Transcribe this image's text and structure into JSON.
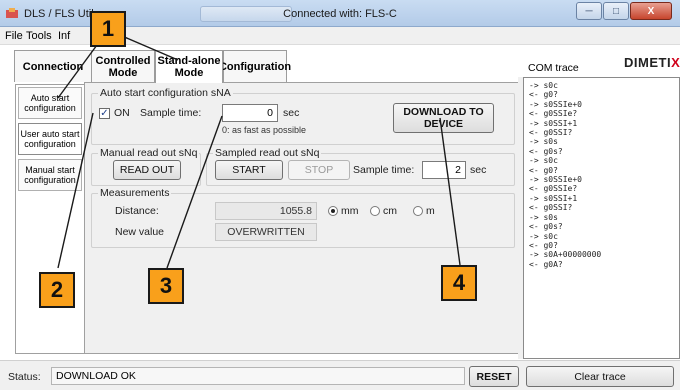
{
  "window": {
    "app_title": "DLS / FLS Util",
    "connection_title": "Connected with: FLS-C",
    "minimize_label": "─",
    "maximize_label": "□",
    "close_label": "X"
  },
  "menu": {
    "items": [
      "File",
      "Tools",
      "Inf"
    ]
  },
  "tabs": [
    {
      "label": "Connection"
    },
    {
      "label": "Controlled Mode"
    },
    {
      "label": "Stand-alone Mode"
    },
    {
      "label": "Configuration"
    }
  ],
  "side_items": [
    {
      "label": "Auto start configuration"
    },
    {
      "label": "User auto start configuration"
    },
    {
      "label": "Manual start configuration"
    }
  ],
  "auto_start": {
    "group_title": "Auto start configuration sNA",
    "on_label": "ON",
    "on_checked": true,
    "check_mark": "✓",
    "sample_time_label": "Sample time:",
    "sample_time_value": "0",
    "sample_time_unit": "sec",
    "note": "0: as fast as possible",
    "download_label": "DOWNLOAD TO DEVICE"
  },
  "manual": {
    "group_title": "Manual read out sNq",
    "read_out_label": "READ OUT"
  },
  "sampled": {
    "group_title": "Sampled read out sNq",
    "start_label": "START",
    "stop_label": "STOP",
    "sample_time_label": "Sample time:",
    "sample_time_value": "2",
    "sample_time_unit": "sec"
  },
  "measurements": {
    "group_title": "Measurements",
    "distance_label": "Distance:",
    "distance_value": "1055.8",
    "units": [
      "mm",
      "cm",
      "m"
    ],
    "selected_unit": "mm",
    "new_value_label": "New value",
    "new_value": "OVERWRITTEN"
  },
  "trace": {
    "title": "COM trace",
    "brand": "DIMETIX",
    "lines": [
      "-> s0c",
      "<- g0?",
      "-> s0SSIe+0",
      "<- g0SSIe?",
      "-> s0SSI+1",
      "<- g0SSI?",
      "-> s0s",
      "<- g0s?",
      "-> s0c",
      "<- g0?",
      "-> s0SSIe+0",
      "<- g0SSIe?",
      "-> s0SSI+1",
      "<- g0SSI?",
      "-> s0s",
      "<- g0s?",
      "-> s0c",
      "<- g0?",
      "-> s0A+00000000",
      "<- g0A?"
    ]
  },
  "status": {
    "label": "Status:",
    "value": "DOWNLOAD OK",
    "reset_label": "RESET",
    "clear_trace_label": "Clear trace"
  },
  "callouts": [
    "1",
    "2",
    "3",
    "4"
  ],
  "colors": {
    "callout": "#f9a01b",
    "brand_accent": "#d0021b",
    "line": "#1a1a1a"
  }
}
